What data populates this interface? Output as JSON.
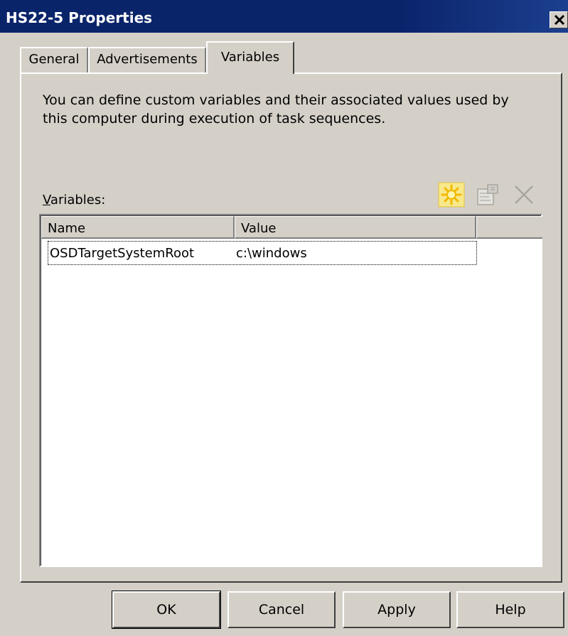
{
  "window": {
    "title": "HS22-5 Properties",
    "close_icon": "close-icon"
  },
  "tabs": [
    {
      "label": "General",
      "selected": false
    },
    {
      "label": "Advertisements",
      "selected": false
    },
    {
      "label": "Variables",
      "selected": true
    }
  ],
  "panel": {
    "description_line1": "You can define custom variables and their associated values used by",
    "description_line2": "this computer during execution of task sequences.",
    "variables_label_accel": "V",
    "variables_label_rest": "ariables:"
  },
  "toolbar": {
    "new_icon": "new-variable-icon",
    "properties_icon": "properties-icon",
    "delete_icon": "delete-icon"
  },
  "list": {
    "columns": [
      "Name",
      "Value"
    ],
    "rows": [
      {
        "name": "OSDTargetSystemRoot",
        "value": "c:\\windows"
      }
    ]
  },
  "buttons": {
    "ok": "OK",
    "cancel": "Cancel",
    "apply": "Apply",
    "help": "Help"
  },
  "colors": {
    "titlebar": "#0a246a",
    "face": "#d4d0c8",
    "new_icon": "#f2c500"
  }
}
